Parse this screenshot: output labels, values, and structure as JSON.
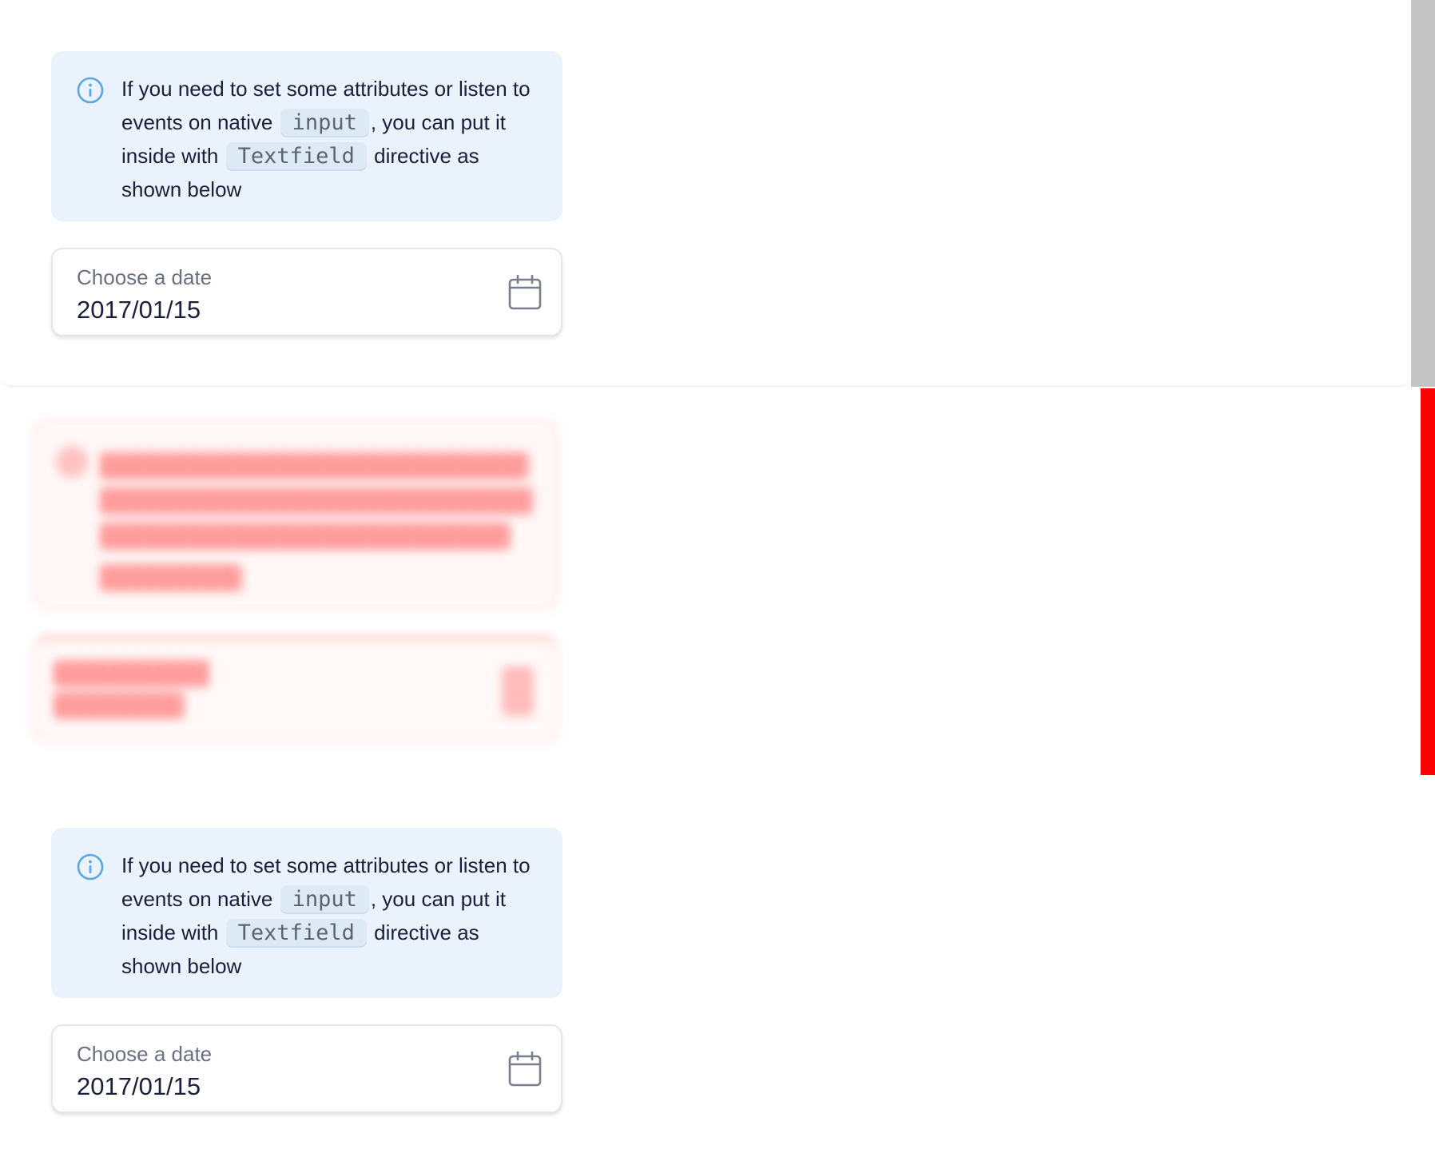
{
  "hint": {
    "icon": "info-icon",
    "text_before_input": "If you need to set some attributes or listen to events on native ",
    "code_input": "input",
    "text_middle": ", you can put it inside with ",
    "code_textfield": "Textfield",
    "text_after": " directive as shown below"
  },
  "date_field": {
    "label": "Choose a date",
    "value": "2017/01/15",
    "icon": "calendar-icon"
  },
  "colors": {
    "hint_bg": "#eaf3fc",
    "info_icon": "#5aa7e6",
    "scrollbar": "#c4c4c4",
    "scrollbar_highlight": "#ff0000"
  }
}
